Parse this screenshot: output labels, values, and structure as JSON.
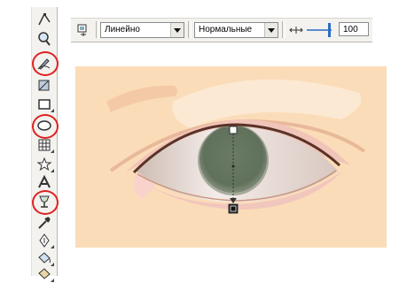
{
  "property_bar": {
    "transparency_type": "Линейно",
    "merge_mode": "Нормальные",
    "opacity_value": "100"
  },
  "toolbox": {
    "tools": [
      {
        "name": "shape-tool",
        "icon": "shape-edit-icon"
      },
      {
        "name": "zoom-tool",
        "icon": "zoom-icon"
      },
      {
        "name": "freehand-tool",
        "icon": "freehand-pencil-icon",
        "highlighted": true
      },
      {
        "name": "smart-fill-tool",
        "icon": "smart-fill-icon"
      },
      {
        "name": "rectangle-tool",
        "icon": "rectangle-icon"
      },
      {
        "name": "ellipse-tool",
        "icon": "ellipse-icon",
        "highlighted": true
      },
      {
        "name": "graph-paper-tool",
        "icon": "grid-icon"
      },
      {
        "name": "polygon-tool",
        "icon": "star-icon"
      },
      {
        "name": "text-tool",
        "icon": "text-a-icon"
      },
      {
        "name": "interactive-transparency-tool",
        "icon": "wine-glass-icon",
        "highlighted": true
      },
      {
        "name": "eyedropper-tool",
        "icon": "eyedropper-icon"
      },
      {
        "name": "outline-tool",
        "icon": "pen-nib-icon"
      },
      {
        "name": "fill-tool",
        "icon": "bucket-icon"
      },
      {
        "name": "interactive-fill-tool",
        "icon": "interactive-fill-icon"
      }
    ]
  },
  "colors": {
    "skin": "#fbdcb8",
    "iris": "#5f6e5a",
    "highlight": "#e02020"
  }
}
